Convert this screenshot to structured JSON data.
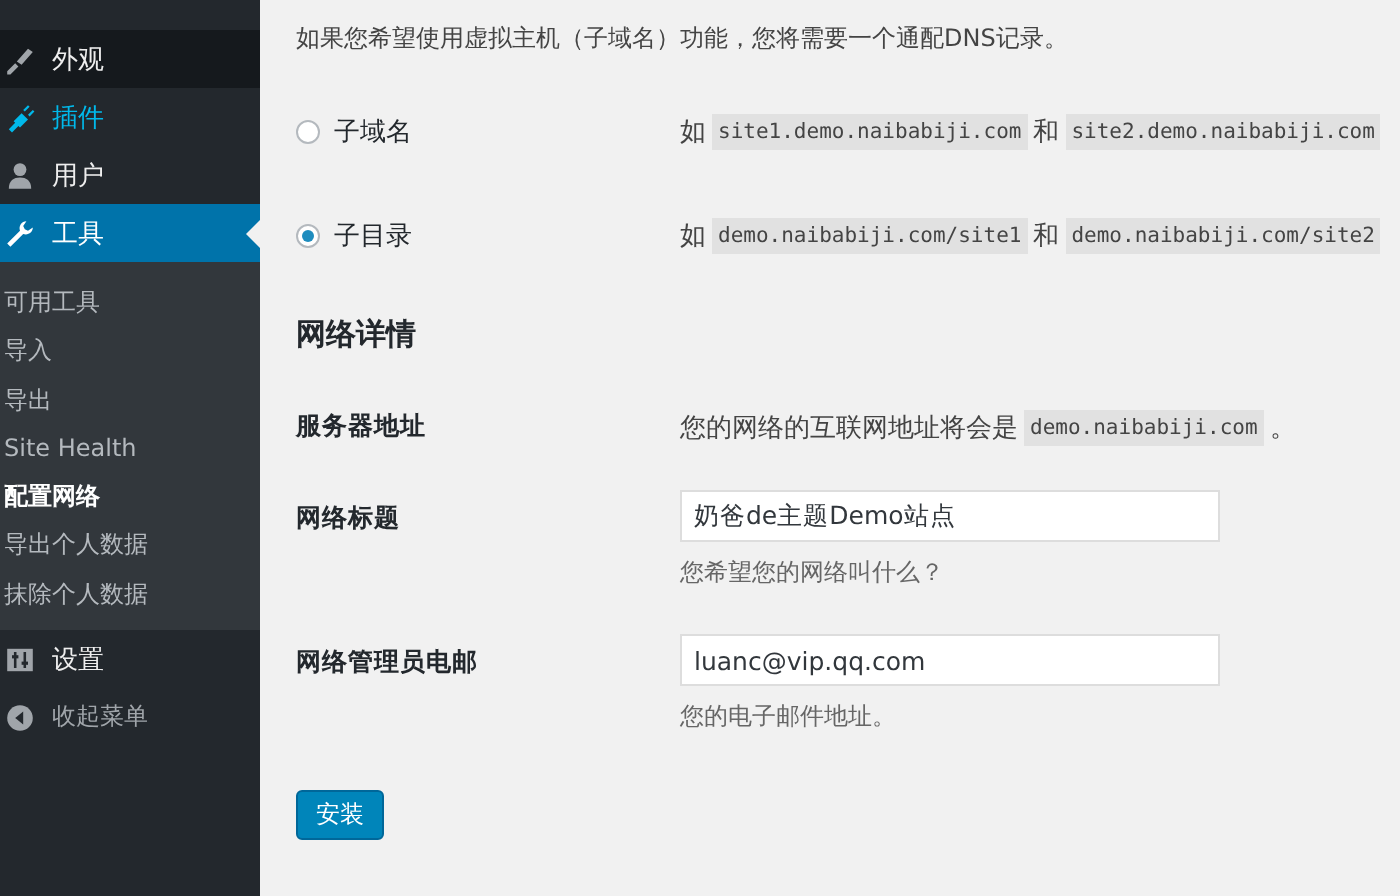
{
  "sidebar": {
    "items": [
      {
        "label": "外观",
        "selected": false,
        "highlighted": true,
        "hovered": false
      },
      {
        "label": "插件",
        "selected": false,
        "highlighted": false,
        "hovered": true
      },
      {
        "label": "用户",
        "selected": false,
        "highlighted": false,
        "hovered": false
      },
      {
        "label": "工具",
        "selected": true,
        "highlighted": false,
        "hovered": false,
        "submenu": [
          {
            "label": "可用工具",
            "selected": false
          },
          {
            "label": "导入",
            "selected": false
          },
          {
            "label": "导出",
            "selected": false
          },
          {
            "label": "Site Health",
            "selected": false
          },
          {
            "label": "配置网络",
            "selected": true
          },
          {
            "label": "导出个人数据",
            "selected": false
          },
          {
            "label": "抹除个人数据",
            "selected": false
          }
        ]
      },
      {
        "label": "设置",
        "selected": false,
        "highlighted": false,
        "hovered": false
      }
    ],
    "collapse": {
      "label": "收起菜单"
    }
  },
  "intro": "如果您希望使用虚拟主机（子域名）功能，您将需要一个通配DNS记录。",
  "address_options": [
    {
      "label": "子域名",
      "selected": false,
      "prefix": "如",
      "example_1": "site1.demo.naibabiji.com",
      "joiner": "和",
      "example_2": "site2.demo.naibabiji.com"
    },
    {
      "label": "子目录",
      "selected": true,
      "prefix": "如",
      "example_1": "demo.naibabiji.com/site1",
      "joiner": "和",
      "example_2": "demo.naibabiji.com/site2"
    }
  ],
  "network_details": {
    "heading": "网络详情",
    "server_address": {
      "label": "服务器地址",
      "text": "您的网络的互联网地址将会是",
      "code": "demo.naibabiji.com",
      "suffix": "。"
    },
    "fields": [
      {
        "label": "网络标题",
        "value": "奶爸de主题Demo站点",
        "description": "您希望您的网络叫什么？"
      },
      {
        "label": "网络管理员电邮",
        "value": "luanc@vip.qq.com",
        "description": "您的电子邮件地址。"
      }
    ]
  },
  "install_button": "安装"
}
